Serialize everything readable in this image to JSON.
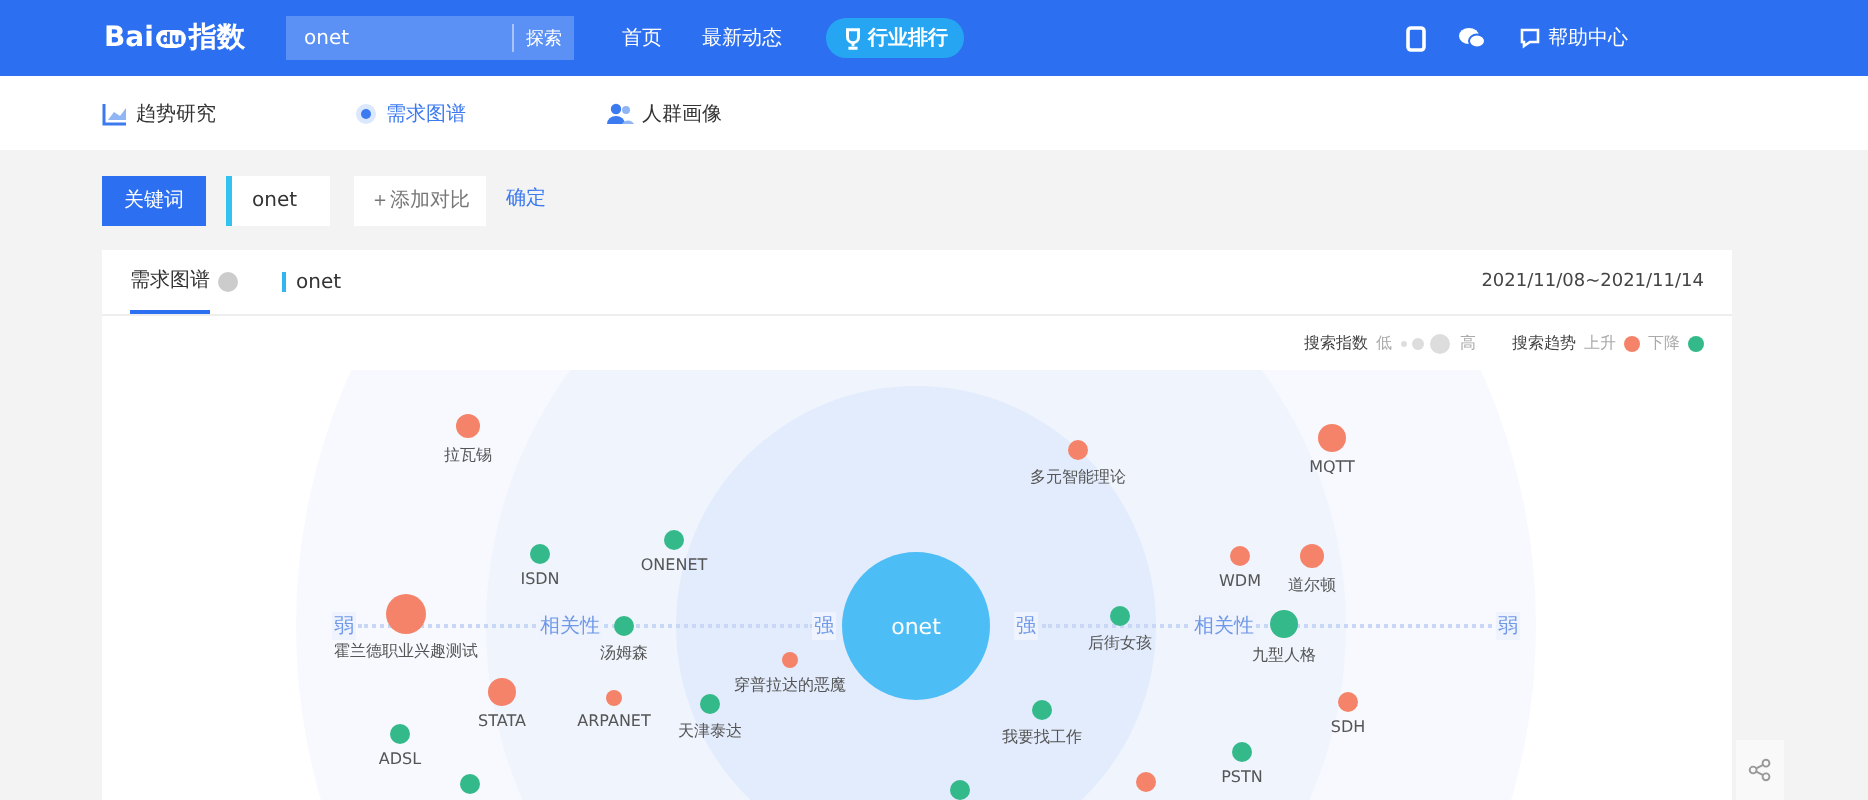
{
  "header": {
    "logo": [
      "Bai",
      "du",
      "指数"
    ],
    "search": {
      "value": "onet",
      "button": "探索"
    },
    "nav": [
      {
        "label": "首页",
        "kind": "link"
      },
      {
        "label": "最新动态",
        "kind": "link"
      },
      {
        "label": "行业排行",
        "kind": "pill"
      }
    ],
    "help": "帮助中心"
  },
  "subnav": [
    {
      "label": "趋势研究",
      "kind": "chart",
      "selected": false
    },
    {
      "label": "需求图谱",
      "kind": "graph",
      "selected": true
    },
    {
      "label": "人群画像",
      "kind": "people",
      "selected": false
    }
  ],
  "toolbar": {
    "keyword_button": "关键词",
    "keyword": "onet",
    "add": "＋添加对比",
    "confirm": "确定"
  },
  "card": {
    "tabs": [
      {
        "label": "需求图谱",
        "selected": true
      }
    ],
    "series": "onet",
    "date": "2021/11/08~2021/11/14",
    "legend": {
      "index_label": "搜索指数",
      "low": "低",
      "high": "高",
      "trend_label": "搜索趋势",
      "trends": [
        {
          "label": "上升",
          "color": "#f5836a"
        },
        {
          "label": "下降",
          "color": "#33b98a"
        }
      ]
    }
  },
  "graph": {
    "center": "onet",
    "axis": {
      "weak_left": "弱",
      "relevance_left": "相关性",
      "strong_left": "强",
      "strong_right": "强",
      "relevance_right": "相关性",
      "weak_right": "弱"
    },
    "nodes": [
      {
        "label": "拉瓦锡",
        "color": "#f5836a",
        "kind": "medium"
      },
      {
        "label": "ISDN",
        "color": "#33b98a",
        "kind": "small"
      },
      {
        "label": "ONENET",
        "color": "#33b98a",
        "kind": "small"
      },
      {
        "label": "霍兰德职业兴趣测试",
        "color": "#f5836a",
        "kind": "xlarge"
      },
      {
        "label": "汤姆森",
        "color": "#33b98a",
        "kind": "small"
      },
      {
        "label": "穿普拉达的恶魔",
        "color": "#f5836a",
        "kind": "tiny"
      },
      {
        "label": "STATA",
        "color": "#f5836a",
        "kind": "large"
      },
      {
        "label": "ARPANET",
        "color": "#f5836a",
        "kind": "tiny"
      },
      {
        "label": "天津泰达",
        "color": "#33b98a",
        "kind": "small"
      },
      {
        "label": "ADSL",
        "color": "#33b98a",
        "kind": "small"
      },
      {
        "color": "#33b98a",
        "kind": "small"
      },
      {
        "label": "多元智能理论",
        "color": "#f5836a",
        "kind": "small"
      },
      {
        "label": "MQTT",
        "color": "#f5836a",
        "kind": "large"
      },
      {
        "label": "WDM",
        "color": "#f5836a",
        "kind": "small"
      },
      {
        "label": "道尔顿",
        "color": "#f5836a",
        "kind": "medium"
      },
      {
        "label": "后街女孩",
        "color": "#33b98a",
        "kind": "small"
      },
      {
        "label": "九型人格",
        "color": "#33b98a",
        "kind": "large"
      },
      {
        "label": "SDH",
        "color": "#f5836a",
        "kind": "small"
      },
      {
        "label": "我要找工作",
        "color": "#33b98a",
        "kind": "small"
      },
      {
        "label": "PSTN",
        "color": "#33b98a",
        "kind": "small"
      },
      {
        "color": "#33b98a",
        "kind": "small"
      },
      {
        "color": "#f5836a",
        "kind": "small"
      }
    ]
  }
}
